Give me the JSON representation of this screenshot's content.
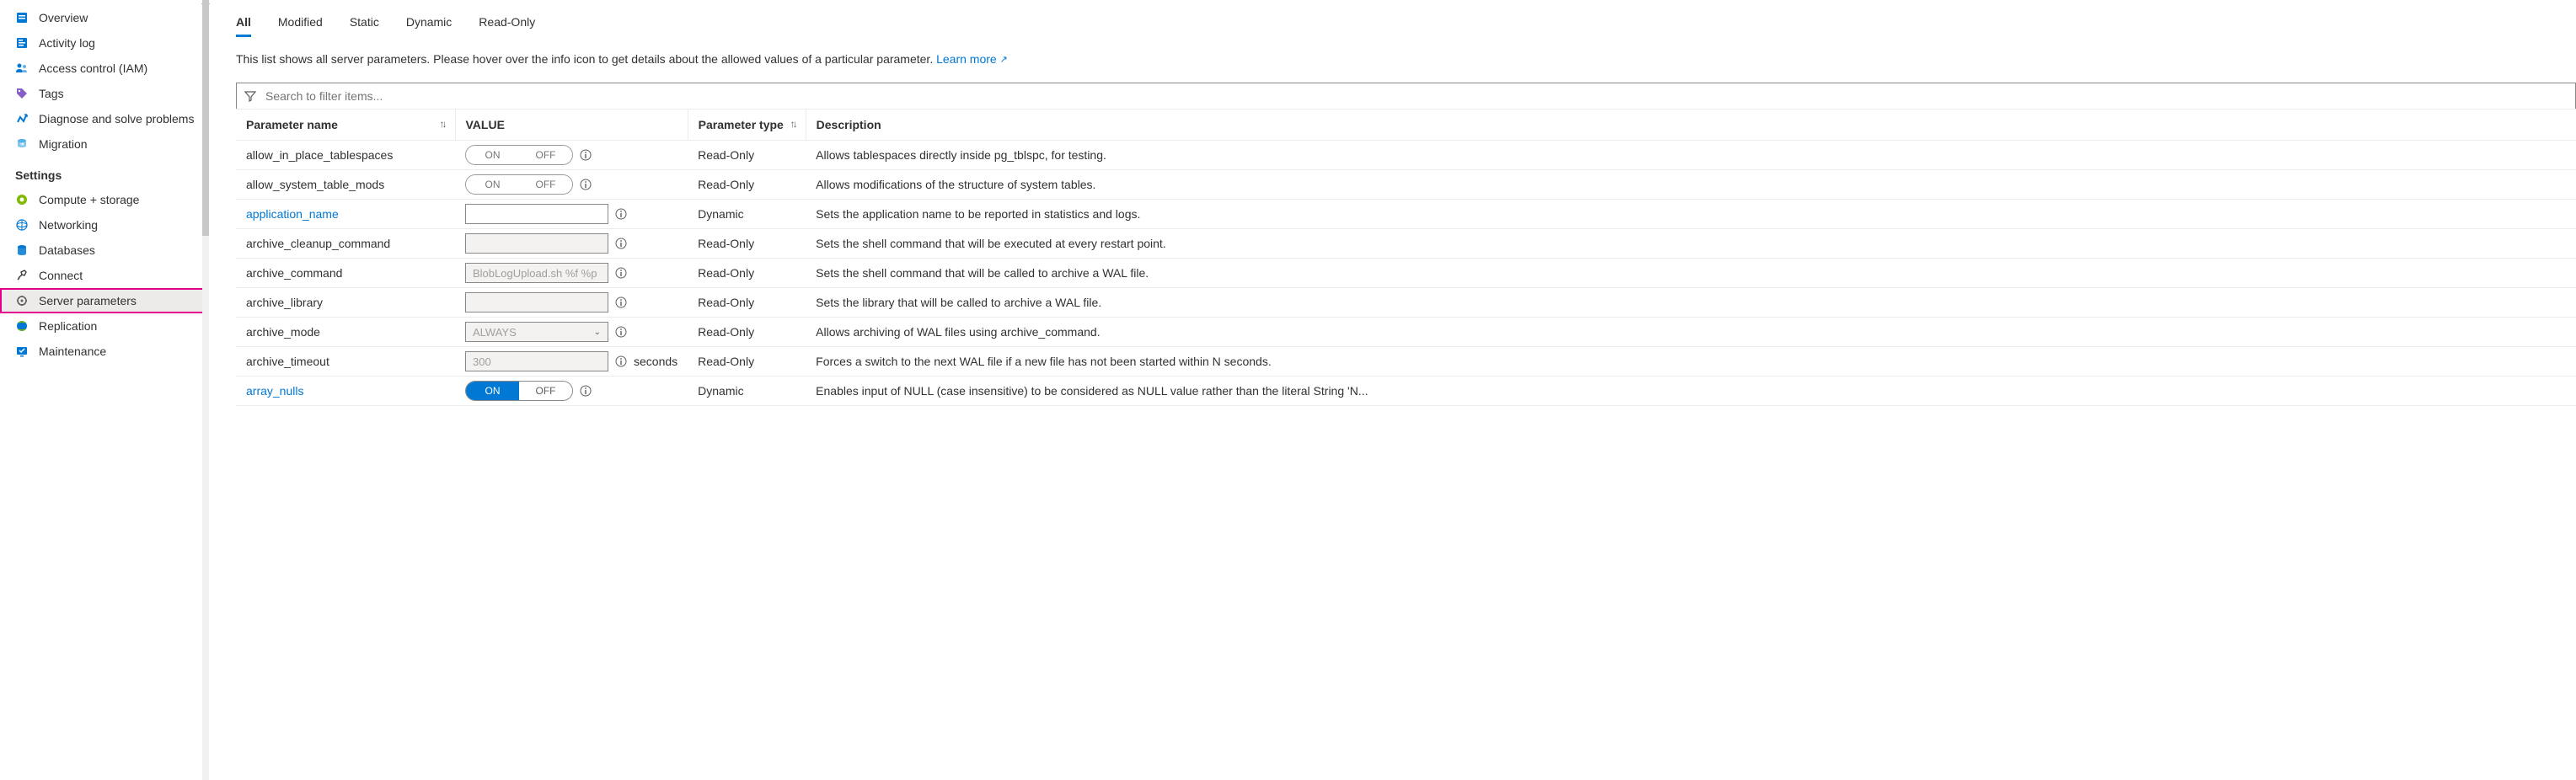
{
  "sidebar": {
    "items": [
      {
        "label": "Overview"
      },
      {
        "label": "Activity log"
      },
      {
        "label": "Access control (IAM)"
      },
      {
        "label": "Tags"
      },
      {
        "label": "Diagnose and solve problems"
      },
      {
        "label": "Migration"
      }
    ],
    "section": "Settings",
    "settings_items": [
      {
        "label": "Compute + storage"
      },
      {
        "label": "Networking"
      },
      {
        "label": "Databases"
      },
      {
        "label": "Connect"
      },
      {
        "label": "Server parameters"
      },
      {
        "label": "Replication"
      },
      {
        "label": "Maintenance"
      }
    ]
  },
  "tabs": [
    "All",
    "Modified",
    "Static",
    "Dynamic",
    "Read-Only"
  ],
  "description_text": "This list shows all server parameters. Please hover over the info icon to get details about the allowed values of a particular parameter. ",
  "learn_more": "Learn more",
  "search_placeholder": "Search to filter items...",
  "headers": {
    "name": "Parameter name",
    "value": "VALUE",
    "type": "Parameter type",
    "desc": "Description"
  },
  "toggle_labels": {
    "on": "ON",
    "off": "OFF"
  },
  "rows": [
    {
      "name": "allow_in_place_tablespaces",
      "control": "toggle-off",
      "type": "Read-Only",
      "desc": "Allows tablespaces directly inside pg_tblspc, for testing.",
      "link": false
    },
    {
      "name": "allow_system_table_mods",
      "control": "toggle-off",
      "type": "Read-Only",
      "desc": "Allows modifications of the structure of system tables.",
      "link": false
    },
    {
      "name": "application_name",
      "control": "input",
      "value": "",
      "type": "Dynamic",
      "desc": "Sets the application name to be reported in statistics and logs.",
      "link": true
    },
    {
      "name": "archive_cleanup_command",
      "control": "input-disabled",
      "value": "",
      "type": "Read-Only",
      "desc": "Sets the shell command that will be executed at every restart point.",
      "link": false
    },
    {
      "name": "archive_command",
      "control": "input-disabled",
      "value": "BlobLogUpload.sh %f %p",
      "type": "Read-Only",
      "desc": "Sets the shell command that will be called to archive a WAL file.",
      "link": false
    },
    {
      "name": "archive_library",
      "control": "input-disabled",
      "value": "",
      "type": "Read-Only",
      "desc": "Sets the library that will be called to archive a WAL file.",
      "link": false
    },
    {
      "name": "archive_mode",
      "control": "select",
      "value": "ALWAYS",
      "type": "Read-Only",
      "desc": "Allows archiving of WAL files using archive_command.",
      "link": false
    },
    {
      "name": "archive_timeout",
      "control": "input-disabled",
      "value": "300",
      "unit": "seconds",
      "type": "Read-Only",
      "desc": "Forces a switch to the next WAL file if a new file has not been started within N seconds.",
      "link": false
    },
    {
      "name": "array_nulls",
      "control": "toggle-on",
      "type": "Dynamic",
      "desc": "Enables input of NULL (case insensitive) to be considered as NULL value rather than the literal String 'N...",
      "link": true
    }
  ]
}
